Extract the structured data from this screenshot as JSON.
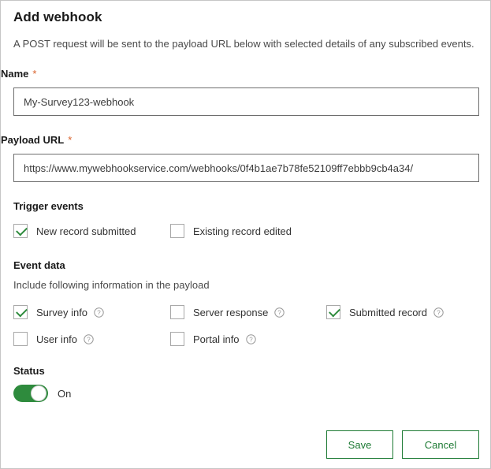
{
  "dialog": {
    "title": "Add webhook",
    "description": "A POST request will be sent to the payload URL below with selected details of any subscribed events."
  },
  "fields": {
    "name": {
      "label": "Name",
      "required_marker": "*",
      "value": "My-Survey123-webhook"
    },
    "payload_url": {
      "label": "Payload URL",
      "required_marker": "*",
      "value": "https://www.mywebhookservice.com/webhooks/0f4b1ae7b78fe52109ff7ebbb9cb4a34/"
    }
  },
  "trigger_events": {
    "heading": "Trigger events",
    "items": [
      {
        "label": "New record submitted",
        "checked": true
      },
      {
        "label": "Existing record edited",
        "checked": false
      }
    ]
  },
  "event_data": {
    "heading": "Event data",
    "subheading": "Include following information in the payload",
    "items": [
      {
        "label": "Survey info",
        "checked": true,
        "help": "help-icon"
      },
      {
        "label": "Server response",
        "checked": false,
        "help": "help-icon"
      },
      {
        "label": "Submitted record",
        "checked": true,
        "help": "help-icon"
      },
      {
        "label": "User info",
        "checked": false,
        "help": "help-icon"
      },
      {
        "label": "Portal info",
        "checked": false,
        "help": "help-icon"
      }
    ]
  },
  "status": {
    "heading": "Status",
    "toggle_state": "on",
    "toggle_label": "On"
  },
  "actions": {
    "save": "Save",
    "cancel": "Cancel"
  },
  "colors": {
    "accent_green": "#1d7a34",
    "toggle_green": "#2e8b3d",
    "required_orange": "#d9622b",
    "border_gray": "#c6c6c6"
  }
}
